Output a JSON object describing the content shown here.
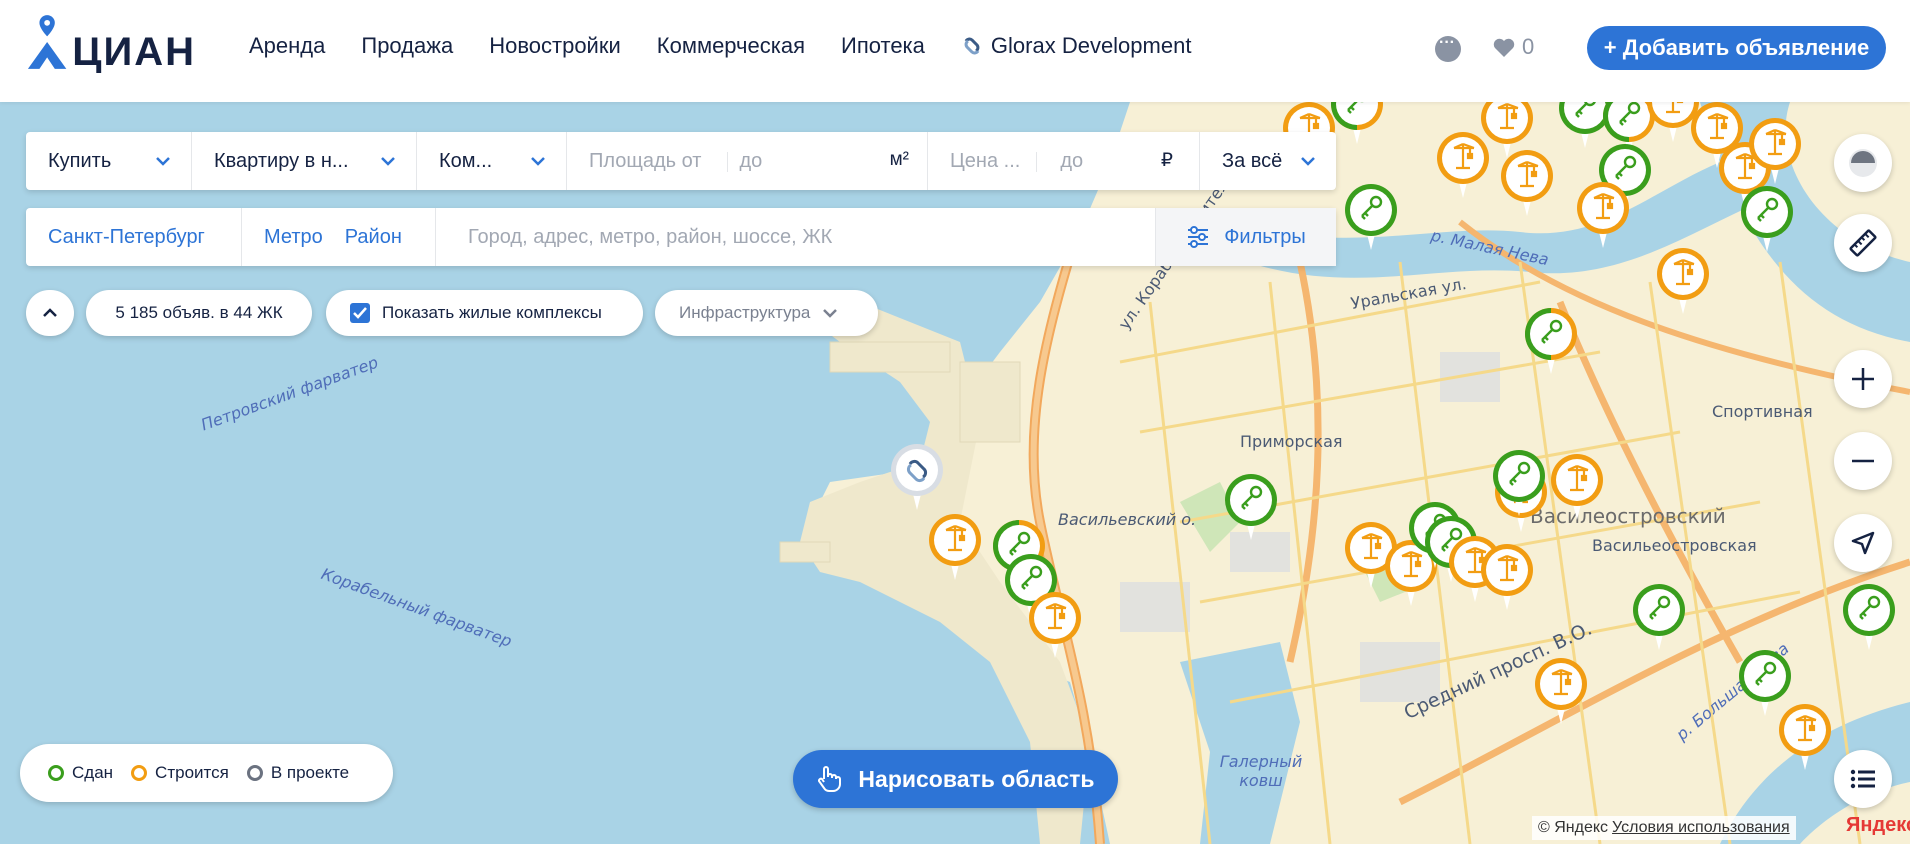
{
  "header": {
    "logo_text": "ЦИАН",
    "nav": [
      "Аренда",
      "Продажа",
      "Новостройки",
      "Коммерческая",
      "Ипотека",
      "Glorax Development"
    ],
    "favorites_count": "0",
    "add_button": "+ Добавить объявление"
  },
  "search": {
    "deal": "Купить",
    "type": "Квартиру в н...",
    "rooms": "Ком...",
    "area_from": "Площадь от",
    "area_to": "до",
    "area_unit": "м²",
    "price_from": "Цена ...",
    "price_to": "до",
    "price_unit": "₽",
    "price_mode": "За всё",
    "city": "Санкт-Петербург",
    "metro": "Метро",
    "district": "Район",
    "address_placeholder": "Город, адрес, метро, район, шоссе, ЖК",
    "filters": "Фильтры"
  },
  "chips": {
    "count": "5 185 объяв. в 44 ЖК",
    "show_complexes": "Показать жилые комплексы",
    "infrastructure": "Инфраструктура"
  },
  "legend": {
    "done": "Сдан",
    "building": "Строится",
    "project": "В проекте",
    "colors": {
      "done": "#3a9e1d",
      "building": "#f29d12",
      "project": "#6b7280"
    }
  },
  "draw_button": "Нарисовать область",
  "map_labels": {
    "petrovsky": "Петровский фарватер",
    "korabelny": "Корабельный фарватер",
    "malaya_neva": "р. Малая Нева",
    "uralskaya": "Уральская ул.",
    "korablestroiteley": "ул. Кораблестроителей",
    "primorskaya": "Приморская",
    "vasilievsky": "Васильевский о.",
    "vasileostrovskaya": "Васильеостровская",
    "sportivnaya": "Спортивная",
    "sredny": "Средний просп. В.О.",
    "galerny": "Галерный ковш",
    "bolshaya_neva": "р. Большая Нева",
    "vasileostrovsky_district": "Василеостровский"
  },
  "copyright": {
    "owner": "© Яндекс",
    "terms": "Условия использования",
    "brand": "Яндекс"
  }
}
